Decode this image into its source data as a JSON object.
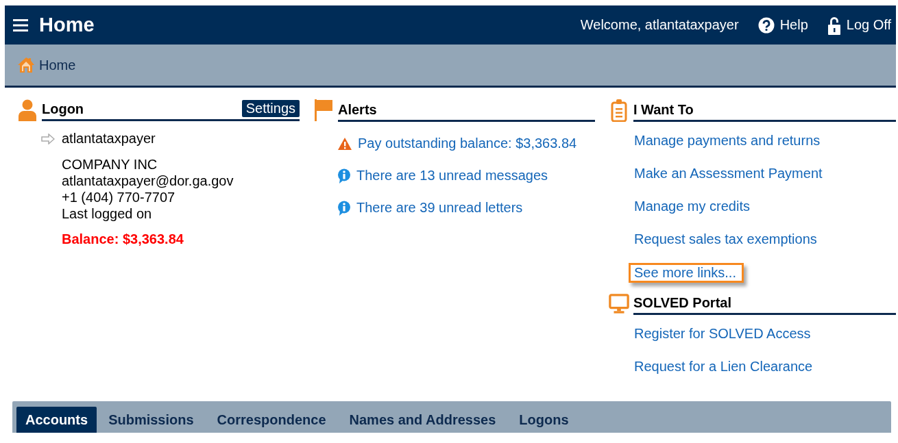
{
  "header": {
    "title": "Home",
    "welcome": "Welcome, atlantataxpayer",
    "help": "Help",
    "logoff": "Log Off"
  },
  "breadcrumb": {
    "label": "Home"
  },
  "logon": {
    "title": "Logon",
    "settings": "Settings",
    "username": "atlantataxpayer",
    "details": [
      "COMPANY INC",
      "atlantataxpayer@dor.ga.gov",
      "+1 (404) 770-7707",
      "Last logged on"
    ],
    "balance": "Balance: $3,363.84"
  },
  "alerts": {
    "title": "Alerts",
    "items": [
      {
        "kind": "warning",
        "text": "Pay outstanding balance: $3,363.84"
      },
      {
        "kind": "info",
        "text": "There are 13 unread messages"
      },
      {
        "kind": "info",
        "text": "There are 39 unread letters"
      }
    ]
  },
  "i_want_to": {
    "title": "I Want To",
    "links": [
      {
        "label": "Manage payments and returns",
        "focused": false
      },
      {
        "label": "Make an Assessment Payment",
        "focused": false
      },
      {
        "label": "Manage my credits",
        "focused": false
      },
      {
        "label": "Request sales tax exemptions",
        "focused": false
      },
      {
        "label": "See more links...",
        "focused": true
      }
    ]
  },
  "solved_portal": {
    "title": "SOLVED Portal",
    "links": [
      {
        "label": "Register for SOLVED Access",
        "focused": false
      },
      {
        "label": "Request for a Lien Clearance",
        "focused": false
      }
    ]
  },
  "tabs": [
    {
      "label": "Accounts",
      "selected": true
    },
    {
      "label": "Submissions",
      "selected": false
    },
    {
      "label": "Correspondence",
      "selected": false
    },
    {
      "label": "Names and Addresses",
      "selected": false
    },
    {
      "label": "Logons",
      "selected": false
    }
  ]
}
